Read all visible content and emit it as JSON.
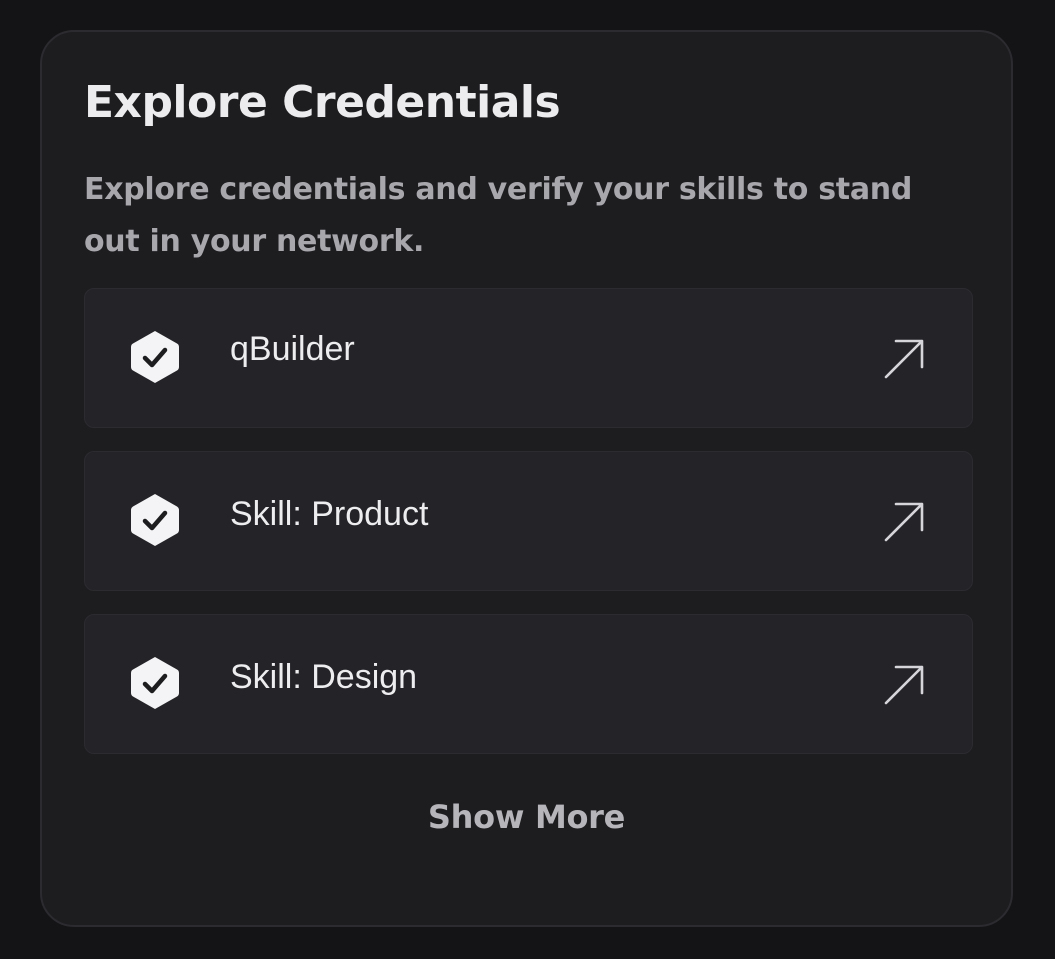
{
  "card": {
    "title": "Explore Credentials",
    "description": "Explore credentials and verify your skills to stand out in your network."
  },
  "credentials": [
    {
      "label": "qBuilder",
      "icon": "verified-badge-icon",
      "action_icon": "arrow-up-right-icon"
    },
    {
      "label": "Skill: Product",
      "icon": "verified-badge-icon",
      "action_icon": "arrow-up-right-icon"
    },
    {
      "label": "Skill: Design",
      "icon": "verified-badge-icon",
      "action_icon": "arrow-up-right-icon"
    }
  ],
  "footer": {
    "show_more_label": "Show More"
  },
  "colors": {
    "page_background": "#141416",
    "card_background": "#1d1d20",
    "item_background": "#242428",
    "title_text": "#ececee",
    "muted_text": "#a7a7ac",
    "badge_fill": "#f4f4f6"
  }
}
